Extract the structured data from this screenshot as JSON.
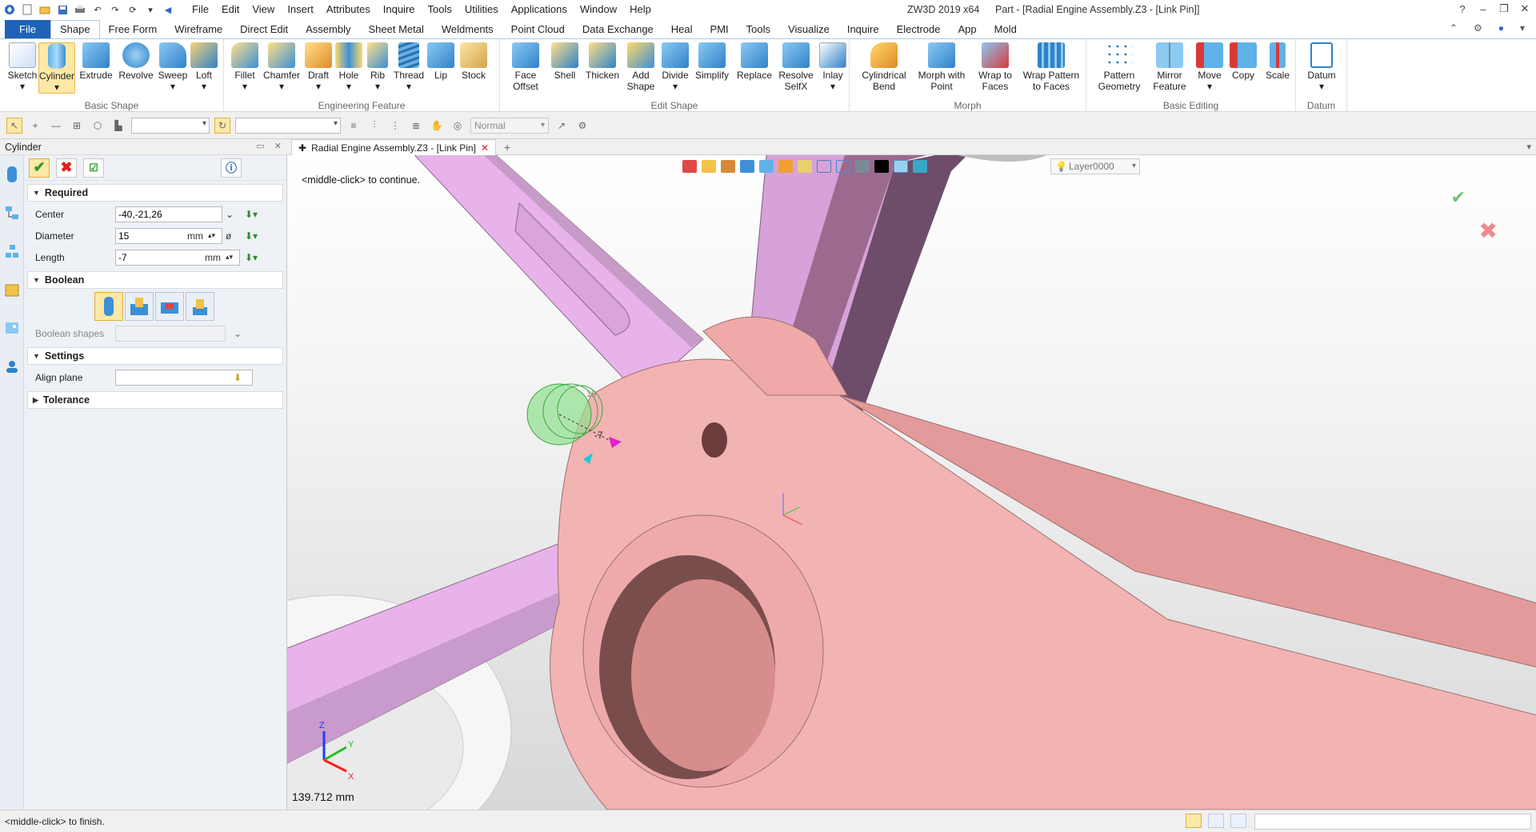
{
  "menu": [
    "File",
    "Edit",
    "View",
    "Insert",
    "Attributes",
    "Inquire",
    "Tools",
    "Utilities",
    "Applications",
    "Window",
    "Help"
  ],
  "app_title": "ZW3D 2019  x64",
  "doc_title": "Part - [Radial Engine Assembly.Z3 - [Link Pin]]",
  "ribbon_tabs": [
    "File",
    "Shape",
    "Free Form",
    "Wireframe",
    "Direct Edit",
    "Assembly",
    "Sheet Metal",
    "Weldments",
    "Point Cloud",
    "Data Exchange",
    "Heal",
    "PMI",
    "Tools",
    "Visualize",
    "Inquire",
    "Electrode",
    "App",
    "Mold"
  ],
  "ribbon_groups": {
    "basic_shape": {
      "label": "Basic Shape",
      "buttons": [
        "Sketch",
        "Cylinder",
        "Extrude",
        "Revolve",
        "Sweep",
        "Loft"
      ]
    },
    "engineering_feature": {
      "label": "Engineering Feature",
      "buttons": [
        "Fillet",
        "Chamfer",
        "Draft",
        "Hole",
        "Rib",
        "Thread",
        "Lip",
        "Stock"
      ]
    },
    "edit_shape": {
      "label": "Edit Shape",
      "buttons": [
        "Face Offset",
        "Shell",
        "Thicken",
        "Add Shape",
        "Divide",
        "Simplify",
        "Replace",
        "Resolve SelfX",
        "Inlay"
      ]
    },
    "morph": {
      "label": "Morph",
      "buttons": [
        "Cylindrical Bend",
        "Morph with Point",
        "Wrap to Faces",
        "Wrap Pattern to Faces"
      ]
    },
    "basic_editing": {
      "label": "Basic Editing",
      "buttons": [
        "Pattern Geometry",
        "Mirror Feature",
        "Move",
        "Copy",
        "Scale"
      ]
    },
    "datum": {
      "label": "Datum",
      "buttons": [
        "Datum"
      ]
    }
  },
  "toolbar": {
    "render_mode": "Normal"
  },
  "panel": {
    "title": "Cylinder",
    "required_label": "Required",
    "center_label": "Center",
    "center_value": "-40,-21,26",
    "diameter_label": "Diameter",
    "diameter_value": "15",
    "length_label": "Length",
    "length_value": "-7",
    "unit": "mm",
    "boolean_label": "Boolean",
    "boolean_shapes_label": "Boolean shapes",
    "settings_label": "Settings",
    "align_plane_label": "Align plane",
    "tolerance_label": "Tolerance"
  },
  "doc_tab": "Radial Engine Assembly.Z3 - [Link Pin]",
  "viewport": {
    "prompt": "<middle-click> to continue.",
    "layer": "Layer0000",
    "distance": "139.712 mm",
    "dim_diameter": "15",
    "dim_length": "-7"
  },
  "status": {
    "text": "<middle-click> to finish."
  },
  "colors": {
    "pink_part": "#f2b3b3",
    "violet_arm": "#e8b2ea",
    "preview_green": "#8fe08f",
    "accent": "#1f62b7"
  }
}
